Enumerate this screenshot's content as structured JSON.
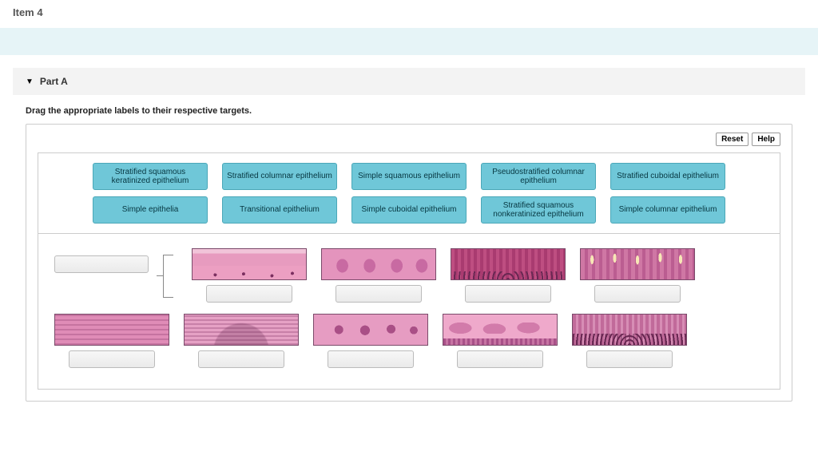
{
  "header": {
    "item_title": "Item 4"
  },
  "part": {
    "title": "Part A",
    "instruction": "Drag the appropriate labels to their respective targets."
  },
  "toolbar": {
    "reset_label": "Reset",
    "help_label": "Help"
  },
  "labels": {
    "row1": [
      "Stratified squamous keratinized epithelium",
      "Stratified columnar epithelium",
      "Simple squamous epithelium",
      "Pseudostratified columnar epithelium",
      "Stratified cuboidal epithelium"
    ],
    "row2": [
      "Simple epithelia",
      "Transitional epithelium",
      "Simple cuboidal epithelium",
      "Stratified squamous nonkeratinized epithelium",
      "Simple columnar epithelium"
    ]
  }
}
